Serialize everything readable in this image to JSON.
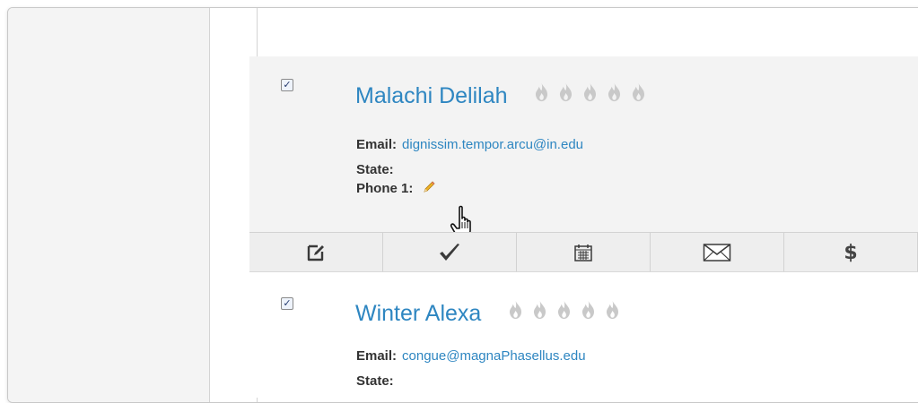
{
  "contacts": [
    {
      "name": "Malachi Delilah",
      "checked": true,
      "check_mark": "✓",
      "rating_icon": "flame-icon",
      "rating": 0,
      "rating_max": 5,
      "email_label": "Email:",
      "email": "dignissim.tempor.arcu@in.edu",
      "state_label": "State:",
      "state": "",
      "phone_label": "Phone 1:",
      "phone": ""
    },
    {
      "name": "Winter Alexa",
      "checked": true,
      "check_mark": "✓",
      "rating_icon": "flame-icon",
      "rating": 0,
      "rating_max": 5,
      "email_label": "Email:",
      "email": "congue@magnaPhasellus.edu",
      "state_label": "State:"
    }
  ],
  "actions": [
    {
      "name": "edit-note-icon"
    },
    {
      "name": "check-icon"
    },
    {
      "name": "calendar-icon"
    },
    {
      "name": "mail-icon"
    },
    {
      "name": "dollar-icon",
      "label": "$"
    }
  ],
  "colors": {
    "link": "#2e86c1",
    "card_bg": "#f3f3f3",
    "flame": "#c9c9c9",
    "pencil": "#f0b429"
  }
}
